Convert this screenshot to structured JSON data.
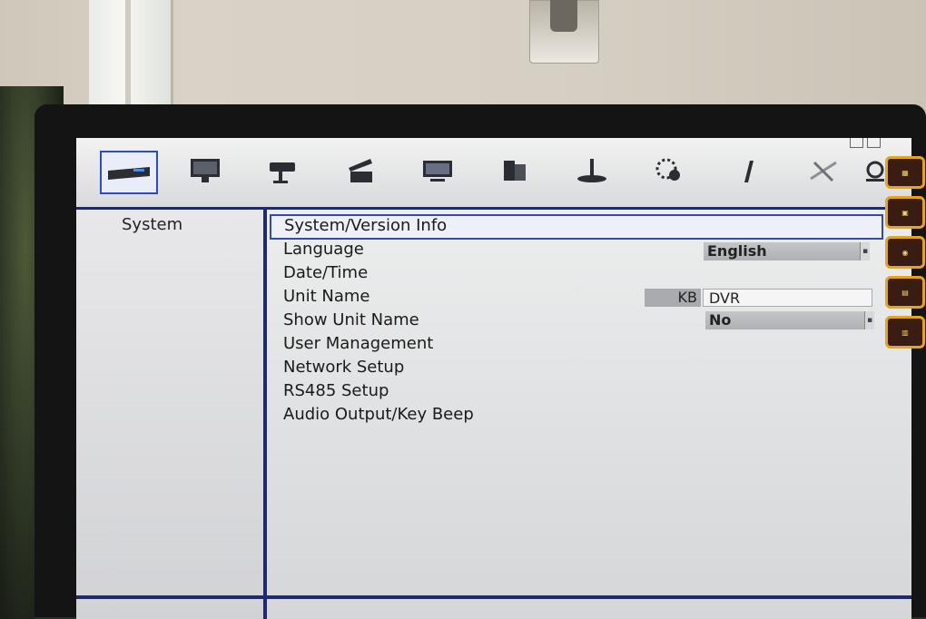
{
  "menu": {
    "icons": [
      {
        "name": "dvr-system-icon",
        "selected": true
      },
      {
        "name": "monitor-icon",
        "selected": false
      },
      {
        "name": "camera-icon",
        "selected": false
      },
      {
        "name": "record-clapper-icon",
        "selected": false
      },
      {
        "name": "display-icon",
        "selected": false
      },
      {
        "name": "network-devices-icon",
        "selected": false
      },
      {
        "name": "user-stand-icon",
        "selected": false
      },
      {
        "name": "disk-icon",
        "selected": false
      },
      {
        "name": "usb-icon",
        "selected": false
      },
      {
        "name": "tools-icon",
        "selected": false
      },
      {
        "name": "logout-icon",
        "selected": false
      }
    ]
  },
  "sidebar": {
    "category": "System"
  },
  "settings": {
    "items": [
      {
        "label": "System/Version Info"
      },
      {
        "label": "Language",
        "value": "English"
      },
      {
        "label": "Date/Time"
      },
      {
        "label": "Unit Name",
        "kb": "KB",
        "value": "DVR"
      },
      {
        "label": "Show Unit Name",
        "value": "No"
      },
      {
        "label": "User Management"
      },
      {
        "label": "Network Setup"
      },
      {
        "label": "RS485 Setup"
      },
      {
        "label": "Audio Output/Key Beep"
      }
    ]
  },
  "colors": {
    "accent": "#1e2a6e",
    "focus": "#3347b6",
    "side_button_border": "#e7a514"
  }
}
